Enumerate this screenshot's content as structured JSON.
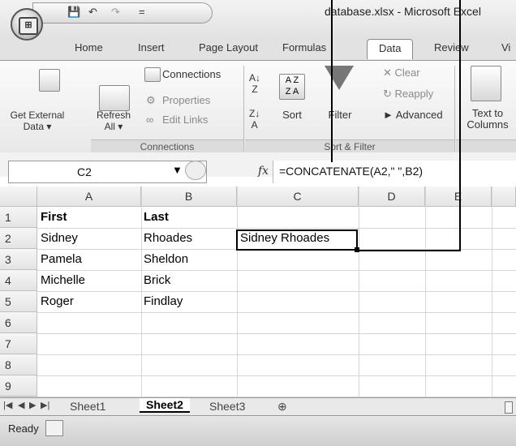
{
  "window": {
    "title": "database.xlsx - Microsoft Excel"
  },
  "quick_access": {
    "save_icon": "save-icon",
    "undo": "↶",
    "redo": "↷",
    "dropdown": "="
  },
  "tabs": [
    {
      "label": "Home"
    },
    {
      "label": "Insert"
    },
    {
      "label": "Page Layout"
    },
    {
      "label": "Formulas"
    },
    {
      "label": "Data",
      "active": true
    },
    {
      "label": "Review"
    },
    {
      "label": "Vi"
    }
  ],
  "ribbon": {
    "get_external_data": "Get External Data ▾",
    "refresh_all": "Refresh All ▾",
    "connections": "Connections",
    "properties": "Properties",
    "edit_links": "Edit Links",
    "group_connections": "Connections",
    "sort_az": "A↓Z",
    "sort": "Sort",
    "filter": "Filter",
    "clear": "Clear",
    "reapply": "Reapply",
    "advanced": "Advanced",
    "group_sort_filter": "Sort & Filter",
    "text_to_columns": "Text to Columns"
  },
  "formula_bar": {
    "cell_ref": "C2",
    "fx": "fx",
    "formula": "=CONCATENATE(A2,\" \",B2)"
  },
  "columns": [
    "A",
    "B",
    "C",
    "D",
    "E"
  ],
  "rows": [
    {
      "num": "1",
      "a": "First",
      "b": "Last",
      "c": "",
      "bold": true
    },
    {
      "num": "2",
      "a": "Sidney",
      "b": "Rhoades",
      "c": "Sidney Rhoades"
    },
    {
      "num": "3",
      "a": "Pamela",
      "b": "Sheldon",
      "c": ""
    },
    {
      "num": "4",
      "a": "Michelle",
      "b": "Brick",
      "c": ""
    },
    {
      "num": "5",
      "a": "Roger",
      "b": "Findlay",
      "c": ""
    },
    {
      "num": "6",
      "a": "",
      "b": "",
      "c": ""
    },
    {
      "num": "7",
      "a": "",
      "b": "",
      "c": ""
    },
    {
      "num": "8",
      "a": "",
      "b": "",
      "c": ""
    },
    {
      "num": "9",
      "a": "",
      "b": "",
      "c": ""
    }
  ],
  "sheets": [
    "Sheet1",
    "Sheet2",
    "Sheet3"
  ],
  "active_sheet": "Sheet2",
  "status": "Ready"
}
